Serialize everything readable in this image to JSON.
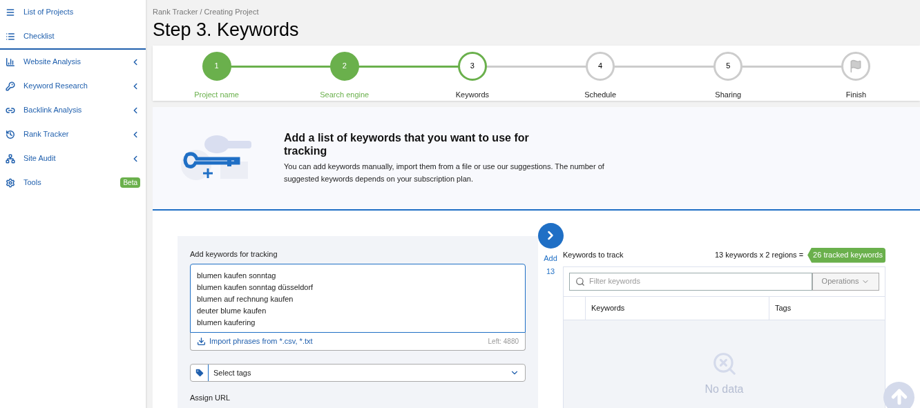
{
  "sidebar": {
    "top_items": [
      {
        "label": "List of Projects"
      },
      {
        "label": "Checklist"
      }
    ],
    "items": [
      {
        "label": "Website Analysis",
        "expandable": true
      },
      {
        "label": "Keyword Research",
        "expandable": true
      },
      {
        "label": "Backlink Analysis",
        "expandable": true
      },
      {
        "label": "Rank Tracker",
        "expandable": true
      },
      {
        "label": "Site Audit",
        "expandable": true
      },
      {
        "label": "Tools",
        "expandable": false,
        "badge": "Beta"
      }
    ]
  },
  "breadcrumb": "Rank Tracker / Creating Project",
  "page_title": "Step 3. Keywords",
  "steps": [
    {
      "number": "1",
      "label": "Project name",
      "done": true,
      "selected": false
    },
    {
      "number": "2",
      "label": "Search engine",
      "done": true,
      "selected": false
    },
    {
      "number": "3",
      "label": "Keywords",
      "done": false,
      "selected": true
    },
    {
      "number": "4",
      "label": "Schedule",
      "done": false,
      "selected": false
    },
    {
      "number": "5",
      "label": "Sharing",
      "done": false,
      "selected": false
    },
    {
      "label": "Finish",
      "done": false,
      "selected": false,
      "kind": "flag"
    }
  ],
  "intro": {
    "heading": "Add a list of keywords that you want to use for tracking",
    "text": "You can add keywords manually, import them from a file or use our suggestions. The number of suggested keywords depends on your subscription plan."
  },
  "add_panel": {
    "label": "Add keywords for tracking",
    "keywords": [
      "blumen kaufen sonntag",
      "blumen kaufen sonntag düsseldorf",
      "blumen auf rechnung kaufen",
      "deuter blume kaufen",
      "blumen kaufering"
    ],
    "import_link": "Import phrases from *.csv, *.txt",
    "left": "Left: 4880",
    "tags_placeholder": "Select tags",
    "assign_url": "Assign URL"
  },
  "add_button": {
    "label": "Add",
    "count": "13"
  },
  "track_panel": {
    "title": "Keywords to track",
    "summary": "13 keywords x 2 regions =",
    "tracked_badge": "26 tracked keywords",
    "filter_placeholder": "Filter keywords",
    "operations": "Operations",
    "columns": [
      "Keywords",
      "Tags"
    ],
    "empty": "No data"
  }
}
